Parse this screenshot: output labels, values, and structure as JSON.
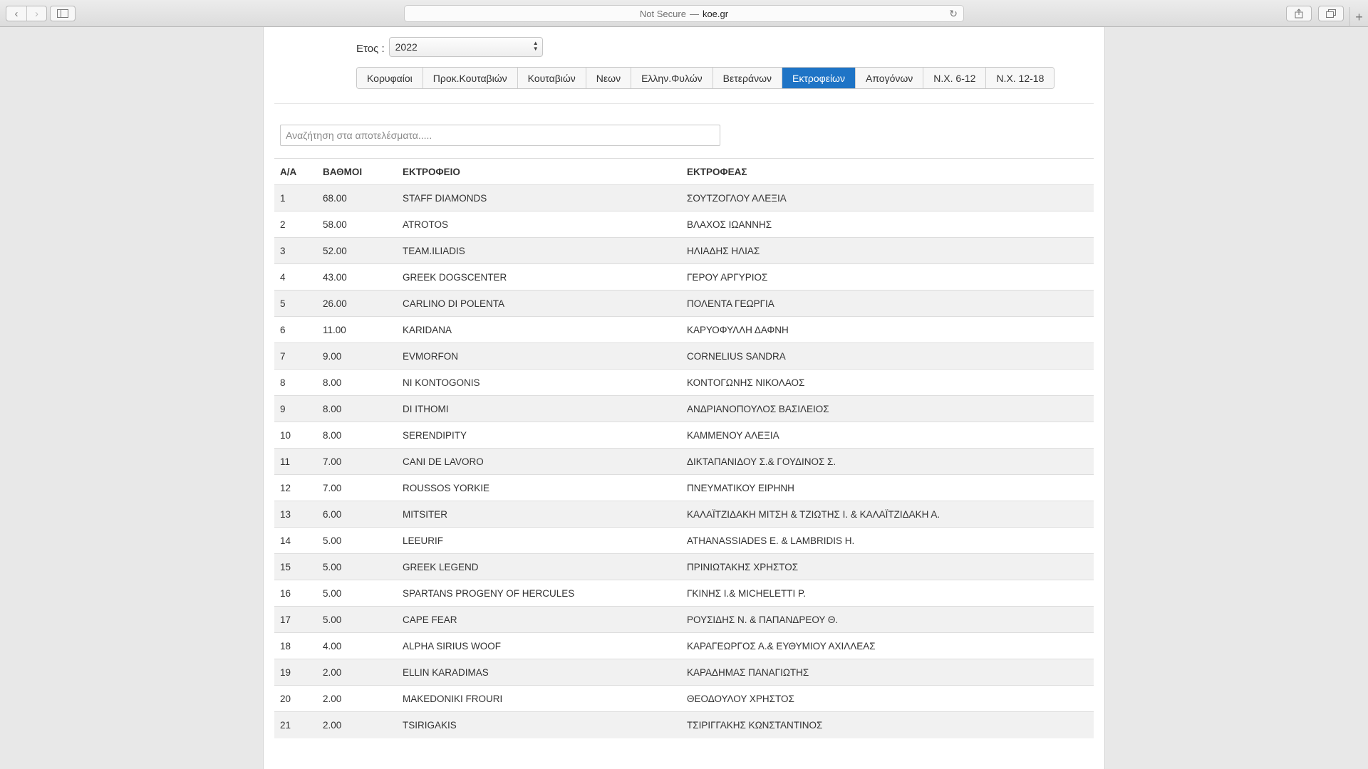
{
  "browser": {
    "security": "Not Secure",
    "separator": "—",
    "domain": "koe.gr"
  },
  "filters": {
    "year_label": "Ετος :",
    "year_value": "2022"
  },
  "tabs": [
    {
      "label": "Κορυφαίοι",
      "active": false
    },
    {
      "label": "Προκ.Κουταβιών",
      "active": false
    },
    {
      "label": "Κουταβιών",
      "active": false
    },
    {
      "label": "Νεων",
      "active": false
    },
    {
      "label": "Ελλην.Φυλών",
      "active": false
    },
    {
      "label": "Βετεράνων",
      "active": false
    },
    {
      "label": "Εκτροφείων",
      "active": true
    },
    {
      "label": "Απογόνων",
      "active": false
    },
    {
      "label": "Ν.Χ. 6-12",
      "active": false
    },
    {
      "label": "Ν.Χ. 12-18",
      "active": false
    }
  ],
  "search": {
    "placeholder": "Αναζήτηση στα αποτελέσματα....."
  },
  "table": {
    "headers": [
      "Α/Α",
      "ΒΑΘΜΟΙ",
      "ΕΚΤΡΟΦΕΙΟ",
      "ΕΚΤΡΟΦΕΑΣ"
    ],
    "rows": [
      [
        "1",
        "68.00",
        "STAFF DIAMONDS",
        "ΣΟΥΤΖΟΓΛΟΥ ΑΛΕΞΙΑ"
      ],
      [
        "2",
        "58.00",
        "ATROTOS",
        "ΒΛΑΧΟΣ ΙΩΑΝΝΗΣ"
      ],
      [
        "3",
        "52.00",
        "TEAM.ILIADIS",
        "ΗΛΙΑΔΗΣ ΗΛΙΑΣ"
      ],
      [
        "4",
        "43.00",
        "GREEK DOGSCENTER",
        "ΓΕΡΟΥ ΑΡΓΥΡΙΟΣ"
      ],
      [
        "5",
        "26.00",
        "CARLINO DI POLENTA",
        "ΠΟΛΕΝΤΑ ΓΕΩΡΓΙΑ"
      ],
      [
        "6",
        "11.00",
        "KARIDANA",
        "ΚΑΡΥΟΦΥΛΛΗ ΔΑΦΝΗ"
      ],
      [
        "7",
        "9.00",
        "EVMORFON",
        "CORNELIUS SANDRA"
      ],
      [
        "8",
        "8.00",
        "NI KONTOGONIS",
        "ΚΟΝΤΟΓΩΝΗΣ ΝΙΚΟΛΑΟΣ"
      ],
      [
        "9",
        "8.00",
        "DI ITHOMI",
        "ΑΝΔΡΙΑΝΟΠΟΥΛΟΣ ΒΑΣΙΛΕΙΟΣ"
      ],
      [
        "10",
        "8.00",
        "SERENDIPITY",
        "ΚΑΜΜΕΝΟΥ ΑΛΕΞΙΑ"
      ],
      [
        "11",
        "7.00",
        "CANI DE LAVORO",
        "ΔΙΚΤΑΠΑΝΙΔΟΥ Σ.& ΓΟΥΔΙΝΟΣ Σ."
      ],
      [
        "12",
        "7.00",
        "ROUSSOS YORKIE",
        "ΠΝΕΥΜΑΤΙΚΟΥ ΕΙΡΗΝΗ"
      ],
      [
        "13",
        "6.00",
        "MITSITER",
        "ΚΑΛΑΪΤΖΙΔΑΚΗ ΜΙΤΣΗ & ΤΖΙΩΤΗΣ Ι. & ΚΑΛΑΪΤΖΙΔΑΚΗ Α."
      ],
      [
        "14",
        "5.00",
        "LEEURIF",
        "ATHANASSIADES E. & LAMBRIDIS H."
      ],
      [
        "15",
        "5.00",
        "GREEK LEGEND",
        "ΠΡΙΝΙΩΤΑΚΗΣ ΧΡΗΣΤΟΣ"
      ],
      [
        "16",
        "5.00",
        "SPARTANS PROGENY OF HERCULES",
        "ΓΚΙΝΗΣ Ι.& MICHELETTI P."
      ],
      [
        "17",
        "5.00",
        "CAPE FEAR",
        "ΡΟΥΣΙΔΗΣ Ν. & ΠΑΠΑΝΔΡΕΟΥ Θ."
      ],
      [
        "18",
        "4.00",
        "ALPHA SIRIUS WOOF",
        "ΚΑΡΑΓΕΩΡΓΟΣ Α.& ΕΥΘΥΜΙΟΥ ΑΧΙΛΛΕΑΣ"
      ],
      [
        "19",
        "2.00",
        "ELLIN KARADIMAS",
        "ΚΑΡΑΔΗΜΑΣ ΠΑΝΑΓΙΩΤΗΣ"
      ],
      [
        "20",
        "2.00",
        "MAKEDONIKI FROURI",
        "ΘΕΟΔΟΥΛΟΥ ΧΡΗΣΤΟΣ"
      ],
      [
        "21",
        "2.00",
        "TSIRIGAKIS",
        "ΤΣΙΡΙΓΓΑΚΗΣ ΚΩΝΣΤΑΝΤΙΝΟΣ"
      ]
    ]
  },
  "colors": {
    "active_tab": "#1e74c6",
    "stripe": "#f1f1f1"
  }
}
